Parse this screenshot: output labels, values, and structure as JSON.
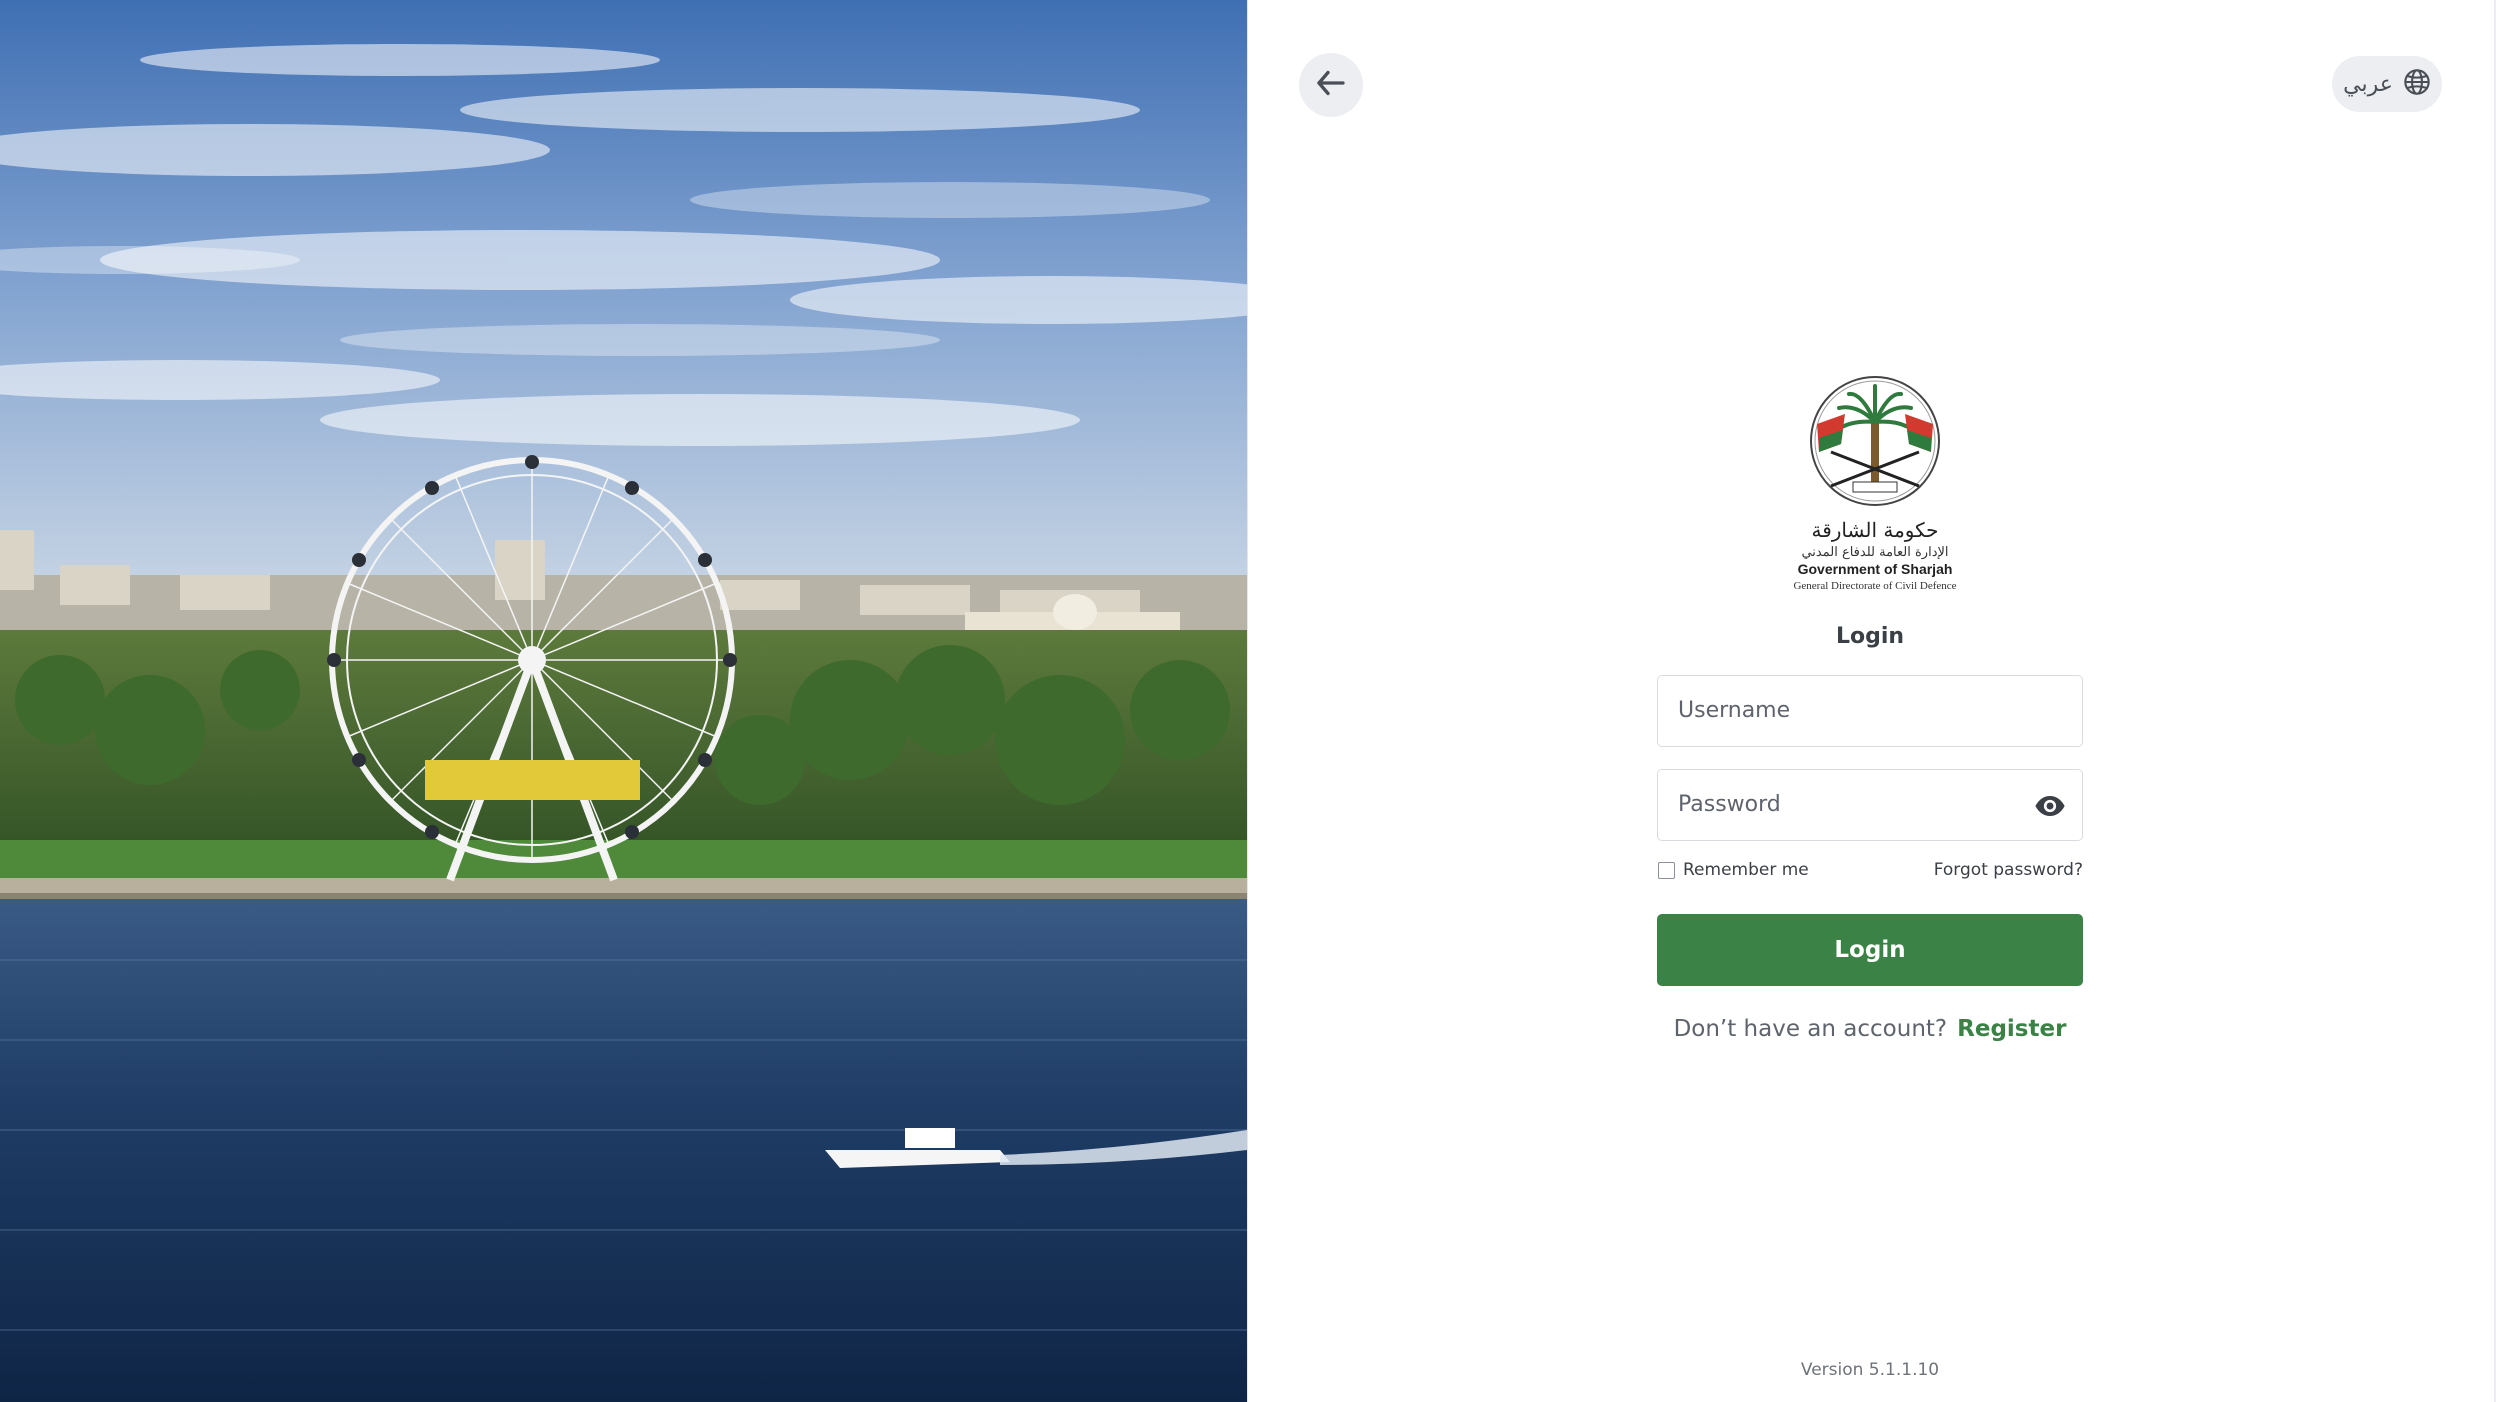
{
  "window": {
    "title": "Government of Sharjah - General Directorate of Civil Defence - Login"
  },
  "header": {
    "back_icon": "arrow-left-icon",
    "language": {
      "label": "عربي",
      "icon": "globe-icon"
    }
  },
  "hero": {
    "description_icon": "sharjah-ferris-wheel-photo"
  },
  "logo": {
    "name_ar": "حكومة الشارقة",
    "subtitle_ar": "الإدارة العامة للدفاع المدني",
    "name_en": "Government of Sharjah",
    "subtitle_en": "General Directorate of Civil Defence"
  },
  "form": {
    "title": "Login",
    "username_placeholder": "Username",
    "password_placeholder": "Password",
    "password_toggle_icon": "eye-icon",
    "remember_label": "Remember me",
    "forgot_label": "Forgot password?",
    "submit_label": "Login",
    "no_account_text": "Don’t have an account?",
    "register_label": "Register"
  },
  "footer": {
    "version": "Version 5.1.1.10"
  },
  "colors": {
    "primary": "#3a8245",
    "icon_button_bg": "#eceef1",
    "text_dark": "#3b3f46",
    "text_muted": "#5f646c",
    "border": "#d8dce1"
  }
}
